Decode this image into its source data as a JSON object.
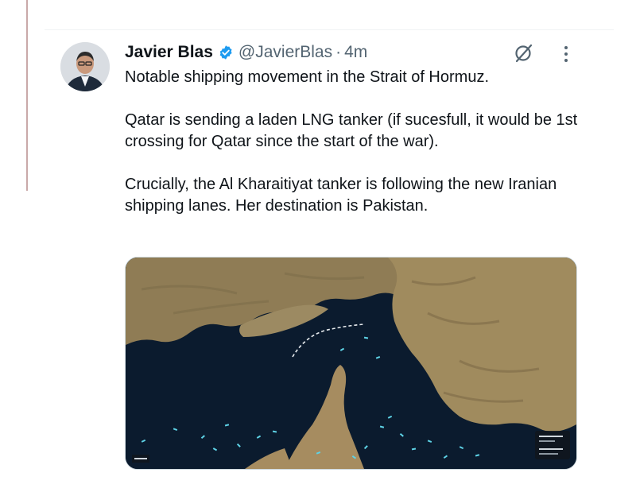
{
  "tweet": {
    "author_name": "Javier Blas",
    "handle": "@JavierBlas",
    "separator": "·",
    "time": "4m",
    "lines": [
      "Notable shipping movement in the Strait of Hormuz.",
      "Qatar is sending a laden LNG tanker (if sucesfull, it would be 1st crossing for Qatar since the start of the war).",
      "Crucially, the Al Kharaitiyat tanker is following the new Iranian shipping lanes. Her destination is Pakistan."
    ]
  },
  "icons": {
    "verified": "verified-badge-icon",
    "grok": "grok-icon",
    "more": "more-icon"
  },
  "colors": {
    "text": "#0f1419",
    "muted": "#536471",
    "verified": "#1d9bf0",
    "sea": "#0b1b2e",
    "land": "#9a8559"
  }
}
